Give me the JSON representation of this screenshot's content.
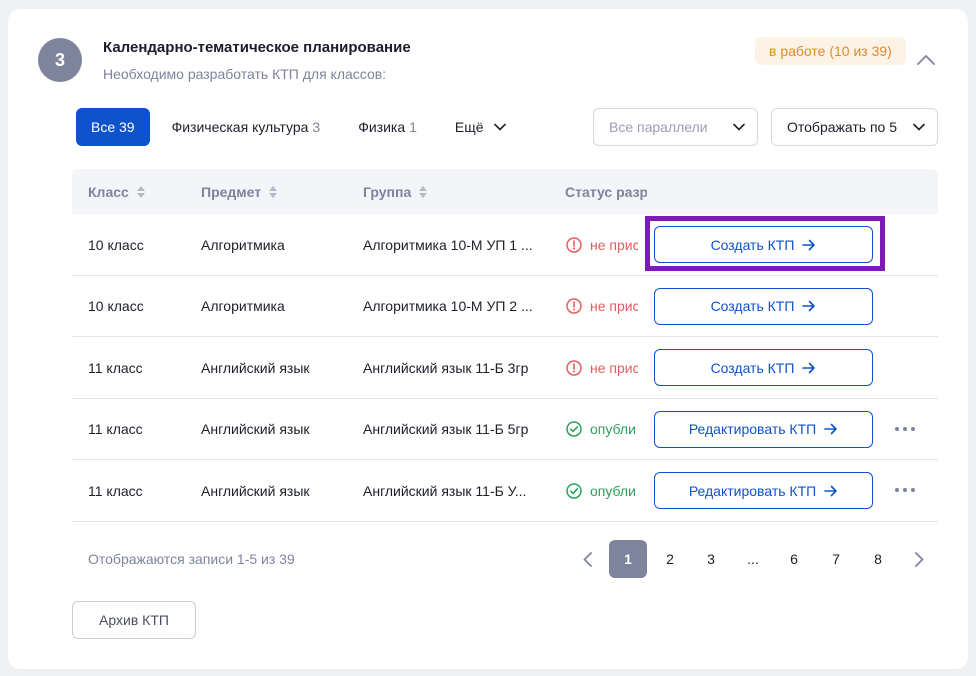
{
  "section": {
    "step_number": "3",
    "title": "Календарно-тематическое планирование",
    "subtitle": "Необходимо разработать КТП для классов:",
    "status_label": "в работе (10 из 39)"
  },
  "filters": {
    "all": "Все 39",
    "tabs": [
      {
        "label": "Физическая культура",
        "count": "3"
      },
      {
        "label": "Физика",
        "count": "1"
      }
    ],
    "more_label": "Ещё",
    "parallels_placeholder": "Все параллели",
    "page_size_label": "Отображать по 5"
  },
  "table": {
    "columns": [
      "Класс",
      "Предмет",
      "Группа",
      "Статус разр"
    ],
    "rows": [
      {
        "class": "10 класс",
        "subject": "Алгоритмика",
        "group": "Алгоритмика 10-М УП 1 ...",
        "status": "не прис",
        "status_type": "error",
        "action": "Создать КТП",
        "has_menu": false
      },
      {
        "class": "10 класс",
        "subject": "Алгоритмика",
        "group": "Алгоритмика 10-М УП 2 ...",
        "status": "не прис",
        "status_type": "error",
        "action": "Создать КТП",
        "has_menu": false
      },
      {
        "class": "11 класс",
        "subject": "Английский язык",
        "group": "Английский язык 11-Б 3гр",
        "status": "не прис",
        "status_type": "error",
        "action": "Создать КТП",
        "has_menu": false
      },
      {
        "class": "11 класс",
        "subject": "Английский язык",
        "group": "Английский язык 11-Б 5гр",
        "status": "опубли",
        "status_type": "ok",
        "action": "Редактировать КТП",
        "has_menu": true
      },
      {
        "class": "11 класс",
        "subject": "Английский язык",
        "group": "Английский язык 11-Б У...",
        "status": "опубли",
        "status_type": "ok",
        "action": "Редактировать КТП",
        "has_menu": true
      }
    ]
  },
  "footer": {
    "records_text": "Отображаются записи 1-5 из 39",
    "pages": [
      "1",
      "2",
      "3",
      "...",
      "6",
      "7",
      "8"
    ],
    "current_page": "1",
    "archive_label": "Архив КТП"
  },
  "colors": {
    "accent": "#0e53cc",
    "badge": "#7d849c",
    "status_in_progress": "#e28a2c",
    "error": "#e35d5d",
    "success": "#2ea05c",
    "highlight": "#7f1ab8"
  }
}
